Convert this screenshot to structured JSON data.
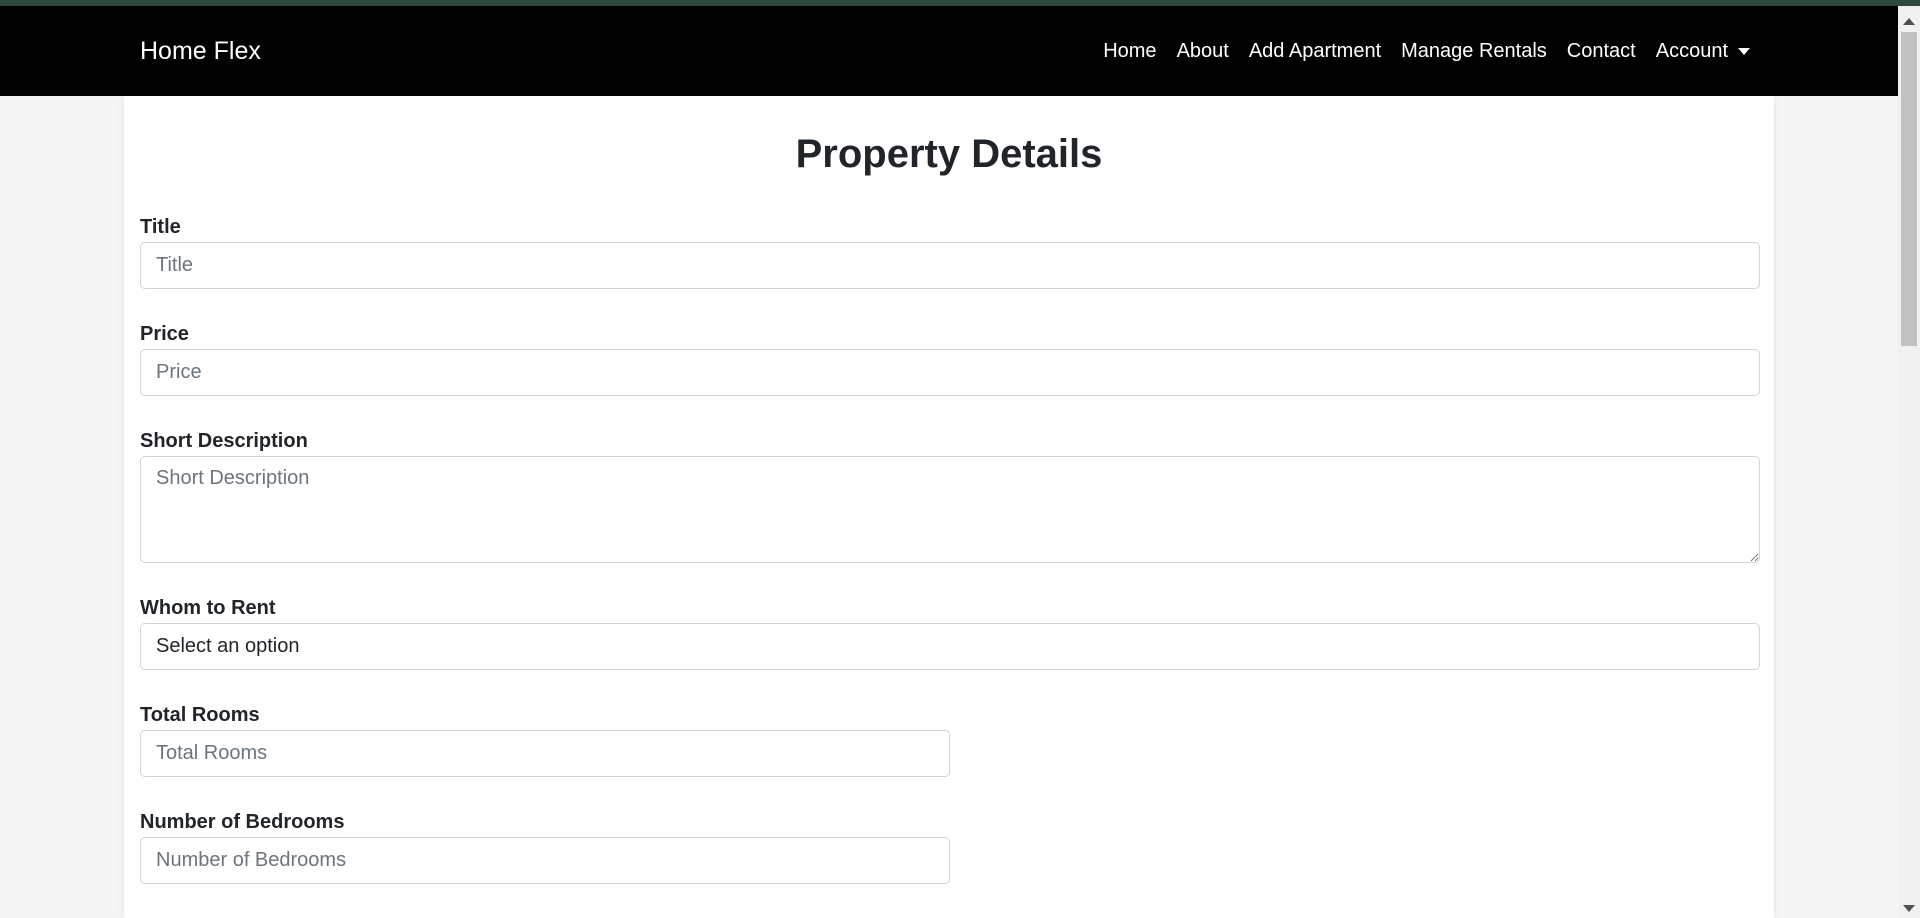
{
  "brand": "Home Flex",
  "nav": {
    "items": [
      "Home",
      "About",
      "Add Apartment",
      "Manage Rentals",
      "Contact"
    ],
    "account": "Account"
  },
  "page_title": "Property Details",
  "form": {
    "title": {
      "label": "Title",
      "placeholder": "Title",
      "value": ""
    },
    "price": {
      "label": "Price",
      "placeholder": "Price",
      "value": ""
    },
    "short_description": {
      "label": "Short Description",
      "placeholder": "Short Description",
      "value": ""
    },
    "whom_to_rent": {
      "label": "Whom to Rent",
      "selected": "Select an option"
    },
    "total_rooms": {
      "label": "Total Rooms",
      "placeholder": "Total Rooms",
      "value": ""
    },
    "bedrooms": {
      "label": "Number of Bedrooms",
      "placeholder": "Number of Bedrooms",
      "value": ""
    }
  },
  "colors": {
    "navbar_bg": "#000000",
    "top_strip": "#2f4a3a",
    "page_bg": "#f5f5f5",
    "card_bg": "#ffffff",
    "input_border": "#ced4da",
    "placeholder": "#6c757d"
  },
  "icons": {
    "account_toggle": "caret-down-icon",
    "scroll_up": "arrow-up-icon",
    "scroll_down": "arrow-down-icon"
  }
}
